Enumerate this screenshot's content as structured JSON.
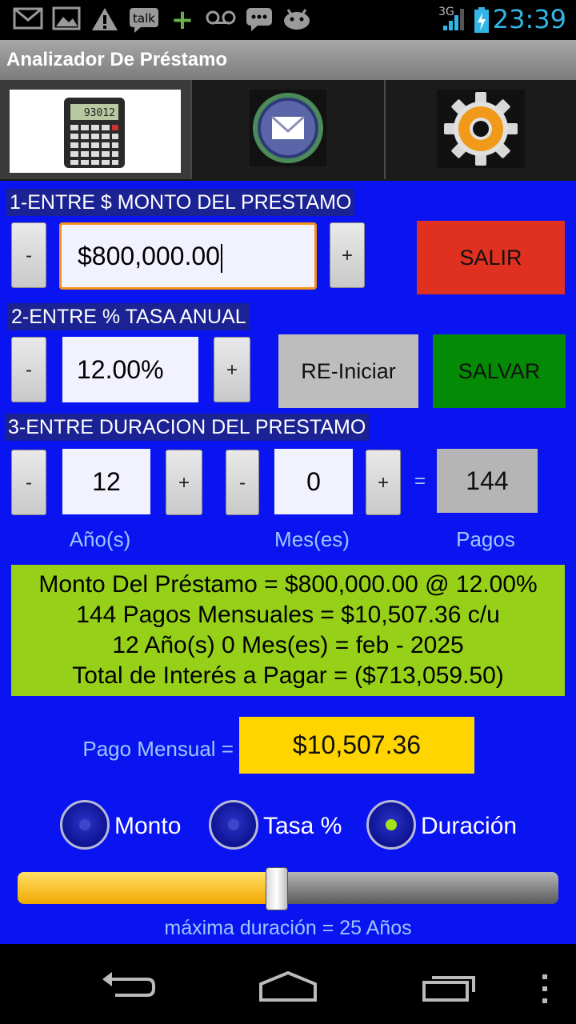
{
  "status_bar": {
    "time": "23:39",
    "network": "3G",
    "notification_icons": [
      "gmail-icon",
      "picture-icon",
      "warning-icon",
      "talk-icon",
      "plus-icon",
      "voicemail-icon",
      "chat-icon",
      "android-icon"
    ],
    "talk_text": "talk"
  },
  "app": {
    "title": "Analizador De Préstamo"
  },
  "tabs": [
    {
      "name": "calculator",
      "icon": "calculator-icon",
      "active": true,
      "display": "93012"
    },
    {
      "name": "email",
      "icon": "email-icon",
      "active": false
    },
    {
      "name": "settings",
      "icon": "settings-gear-icon",
      "active": false
    }
  ],
  "section1": {
    "title": "1-ENTRE $ MONTO DEL PRESTAMO",
    "minus": "-",
    "plus": "+",
    "value": "$800,000.00",
    "exit_label": "SALIR"
  },
  "section2": {
    "title": "2-ENTRE % TASA ANUAL",
    "minus": "-",
    "plus": "+",
    "value": "12.00%",
    "reset_label": "RE-Iniciar",
    "save_label": "SALVAR"
  },
  "section3": {
    "title": "3-ENTRE DURACION DEL PRESTAMO",
    "years_minus": "-",
    "years_plus": "+",
    "years_value": "12",
    "months_minus": "-",
    "months_plus": "+",
    "months_value": "0",
    "equals": "=",
    "payments_value": "144",
    "years_label": "Año(s)",
    "months_label": "Mes(es)",
    "payments_label": "Pagos"
  },
  "summary": {
    "line1": "Monto Del Préstamo = $800,000.00 @ 12.00%",
    "line2": "144 Pagos Mensuales = $10,507.36 c/u",
    "line3": "12 Año(s) 0 Mes(es) = feb - 2025",
    "line4": "Total de Interés a Pagar = ($713,059.50)"
  },
  "payment": {
    "label": "Pago Mensual =",
    "value": "$10,507.36"
  },
  "mode_options": [
    {
      "label": "Monto",
      "checked": false
    },
    {
      "label": "Tasa %",
      "checked": false
    },
    {
      "label": "Duración",
      "checked": true
    }
  ],
  "slider": {
    "level_fraction": 0.48,
    "caption": "máxima duración = 25 Años"
  },
  "colors": {
    "main_bg": "#0a14f0",
    "exit": "#e03020",
    "save": "#058a05",
    "summary_bg": "#96d018",
    "payment_bg": "#ffd500",
    "focus": "#f39318"
  },
  "nav_icons": [
    "back-icon",
    "home-icon",
    "recents-icon",
    "overflow-menu-icon"
  ]
}
